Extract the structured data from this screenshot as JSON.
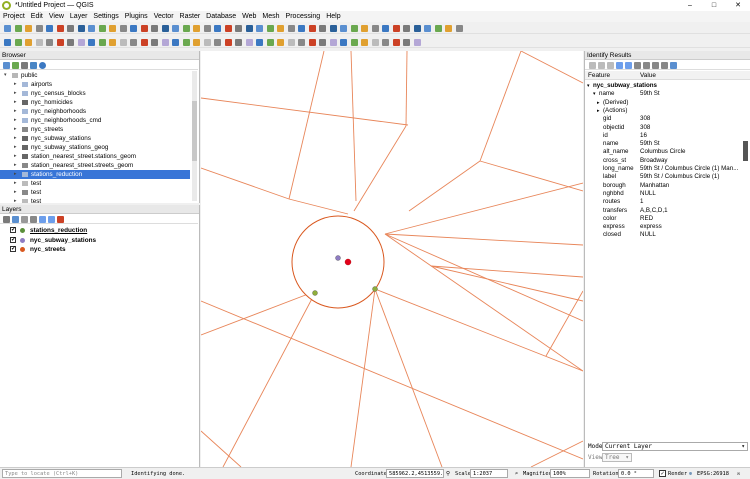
{
  "window": {
    "title": "*Untitled Project — QGIS",
    "controls": [
      "–",
      "□",
      "✕"
    ]
  },
  "menu": [
    "Project",
    "Edit",
    "View",
    "Layer",
    "Settings",
    "Plugins",
    "Vector",
    "Raster",
    "Database",
    "Web",
    "Mesh",
    "Processing",
    "Help"
  ],
  "browser": {
    "title": "Browser",
    "items": [
      {
        "label": "public",
        "icon": "schema-icon",
        "expanded": true
      },
      {
        "label": "airports",
        "icon": "polygon-layer-icon"
      },
      {
        "label": "nyc_census_blocks",
        "icon": "polygon-layer-icon"
      },
      {
        "label": "nyc_homicides",
        "icon": "point-layer-icon"
      },
      {
        "label": "nyc_neighborhoods",
        "icon": "polygon-layer-icon"
      },
      {
        "label": "nyc_neighborhoods_cmd",
        "icon": "polygon-layer-icon"
      },
      {
        "label": "nyc_streets",
        "icon": "line-layer-icon"
      },
      {
        "label": "nyc_subway_stations",
        "icon": "point-layer-icon"
      },
      {
        "label": "nyc_subway_stations_geog",
        "icon": "point-layer-icon"
      },
      {
        "label": "station_nearest_street.stations_geom",
        "icon": "point-layer-icon"
      },
      {
        "label": "station_nearest_street.streets_geom",
        "icon": "line-layer-icon"
      },
      {
        "label": "stations_reduction",
        "icon": "polygon-layer-icon",
        "selected": true
      },
      {
        "label": "test",
        "icon": "table-icon"
      },
      {
        "label": "test",
        "icon": "line-layer-icon"
      },
      {
        "label": "test",
        "icon": "table-icon"
      }
    ]
  },
  "layers": {
    "title": "Layers",
    "items": [
      {
        "label": "stations_reduction",
        "color": "#5a8f3a",
        "underline": true
      },
      {
        "label": "nyc_subway_stations",
        "color": "#8e7cc3"
      },
      {
        "label": "nyc_streets",
        "color": "#d9581f"
      }
    ]
  },
  "identify": {
    "title": "Identify Results",
    "col_feature": "Feature",
    "col_value": "Value",
    "layer": "nyc_subway_stations",
    "root": {
      "field": "name",
      "value": "59th St"
    },
    "sub": [
      "(Derived)",
      "(Actions)"
    ],
    "attributes": [
      {
        "field": "gid",
        "value": "308"
      },
      {
        "field": "objectid",
        "value": "308"
      },
      {
        "field": "id",
        "value": "16"
      },
      {
        "field": "name",
        "value": "59th St"
      },
      {
        "field": "alt_name",
        "value": "Columbus Circle"
      },
      {
        "field": "cross_st",
        "value": "Broadway"
      },
      {
        "field": "long_name",
        "value": "59th St / Columbus Circle (1) Man..."
      },
      {
        "field": "label",
        "value": "59th St / Columbus Circle (1)"
      },
      {
        "field": "borough",
        "value": "Manhattan"
      },
      {
        "field": "nghbhd",
        "value": "NULL"
      },
      {
        "field": "routes",
        "value": "1"
      },
      {
        "field": "transfers",
        "value": "A,B,C,D,1"
      },
      {
        "field": "color",
        "value": "RED"
      },
      {
        "field": "express",
        "value": "express"
      },
      {
        "field": "closed",
        "value": "NULL"
      }
    ],
    "mode_label": "Mode",
    "mode_value": "Current Layer",
    "view_label": "View",
    "view_value": "Tree",
    "help_label": "Help"
  },
  "status": {
    "locate_placeholder": "Type to locate (Ctrl+K)",
    "message": "Identifying done.",
    "coordinate_label": "Coordinate",
    "coordinate": "585962.2,4513559.5",
    "scale_label": "Scale",
    "scale": "1:2037",
    "magnifier_label": "Magnifier",
    "magnifier": "100%",
    "rotation_label": "Rotation",
    "rotation": "0.0 °",
    "render_label": "Render",
    "crs": "EPSG:26918"
  },
  "colors": {
    "streets": "#e8865a",
    "buffer": "#d9581f",
    "selected_station": "#e3001b",
    "station": "#8e7cc3",
    "buffer_point": "#8fae3b"
  }
}
